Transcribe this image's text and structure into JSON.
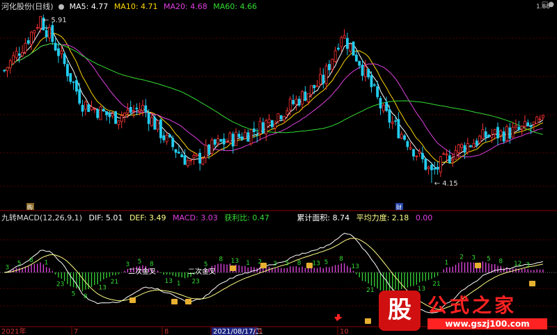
{
  "upper_header": {
    "title": "河化股份(日线)",
    "ma5": {
      "label": "MA5",
      "value": "4.77",
      "color": "#ffffff"
    },
    "ma10": {
      "label": "MA10",
      "value": "4.71",
      "color": "#ffd700"
    },
    "ma20": {
      "label": "MA20",
      "value": "4.68",
      "color": "#e040e0"
    },
    "ma60": {
      "label": "MA60",
      "value": "4.66",
      "color": "#33dd33"
    }
  },
  "lower_header": {
    "indicator": "九转MACD(12,26,9,1)",
    "dif": "DIF: 5.01",
    "def": "DEF: 3.49",
    "macd": "MACD: 3.03",
    "profit_ratio": "获利比: 0.47",
    "cum_area": "累计面积: 8.74",
    "avg_strength": "平均力度: 2.18",
    "extra": "0.00"
  },
  "chart_data": [
    {
      "type": "candlestick",
      "title": "河化股份(日线)",
      "annotations": {
        "high": "5.91",
        "low": "4.15",
        "top_right": "1.88"
      },
      "marker_labels": {
        "left": "购",
        "low": "财"
      },
      "colors": {
        "up": "#ff3333",
        "down": "#22ccee",
        "grid": "#8b0000"
      }
    },
    {
      "type": "bar",
      "title": "九转MACD(12,26,9,1)",
      "annotations": [
        "二次金叉",
        "二次金叉"
      ],
      "counts_visible": [
        "3",
        "5",
        "8",
        "1",
        "23",
        "5",
        "8",
        "13",
        "21",
        "3",
        "5",
        "8",
        "13",
        "1",
        "23",
        "5",
        "8",
        "13",
        "1",
        "2",
        "3",
        "5",
        "8",
        "13",
        "5",
        "8",
        "13",
        "21",
        "3",
        "5",
        "8",
        "13",
        "21",
        "1",
        "2",
        "3",
        "5",
        "8",
        "12",
        "3"
      ],
      "colors": {
        "pos": "#dd44dd",
        "neg": "#33cc33",
        "dif": "#ffffff",
        "dea": "#ffff88"
      }
    }
  ],
  "date_axis": {
    "labels": [
      "2021年",
      "7",
      "8",
      "2021/08/17/二",
      "9",
      "10"
    ],
    "highlight": "2021/08/17/二"
  },
  "watermark": {
    "logo_char": "股",
    "text": "公式之家",
    "url": "www.gszj100.com"
  }
}
